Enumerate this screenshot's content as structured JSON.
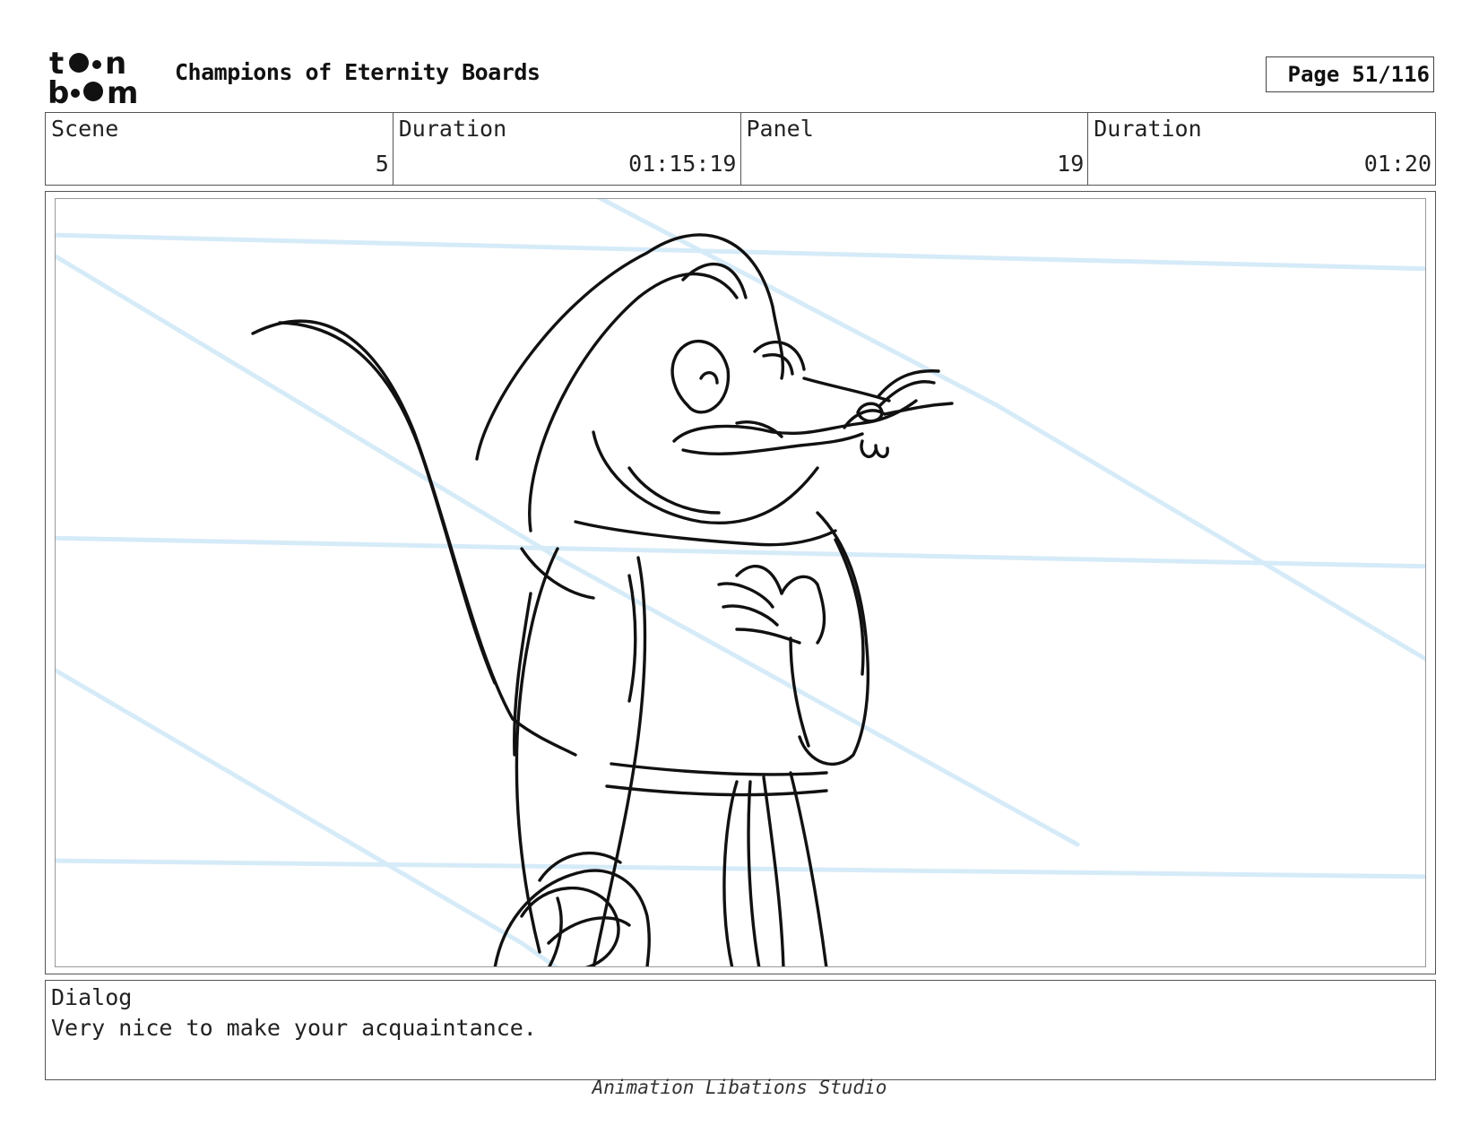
{
  "header": {
    "logo_text_top": "toon",
    "logo_text_bottom": "boom",
    "title": "Champions of Eternity Boards",
    "page_label": "Page",
    "page_value": "51/116"
  },
  "info": [
    {
      "label": "Scene",
      "value": "5"
    },
    {
      "label": "Duration",
      "value": "01:15:19"
    },
    {
      "label": "Panel",
      "value": "19"
    },
    {
      "label": "Duration",
      "value": "01:20"
    }
  ],
  "panel": {
    "content": "rough sketch of a hooded rat character with hand on chest",
    "sketch_color": "#111111",
    "guide_color": "#d6ebf8"
  },
  "dialog": {
    "label": "Dialog",
    "text": "Very nice to make your acquaintance."
  },
  "footer": {
    "studio": "Animation Libations Studio"
  }
}
